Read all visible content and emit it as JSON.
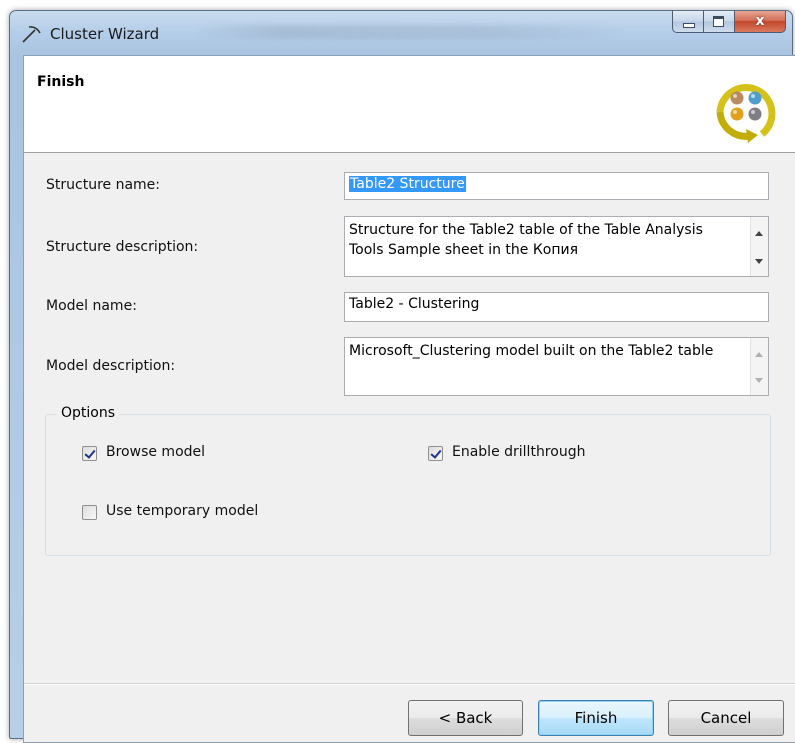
{
  "window": {
    "title": "Cluster Wizard",
    "caption_buttons": {
      "minimize": "minimize",
      "maximize": "maximize",
      "close": "x"
    }
  },
  "header": {
    "title": "Finish",
    "icon": "cluster-wizard-icon"
  },
  "form": {
    "structure_name": {
      "label": "Structure name:",
      "value": "Table2 Structure"
    },
    "structure_description": {
      "label": "Structure description:",
      "value": "Structure for the Table2 table of the Table Analysis Tools Sample sheet in the Копия"
    },
    "model_name": {
      "label": "Model name:",
      "value": "Table2 - Clustering"
    },
    "model_description": {
      "label": "Model description:",
      "value": "Microsoft_Clustering model built on the Table2 table"
    }
  },
  "options": {
    "legend": "Options",
    "browse_model": {
      "label": "Browse model",
      "checked": true
    },
    "enable_drillthrough": {
      "label": "Enable drillthrough",
      "checked": true
    },
    "use_temporary_model": {
      "label": "Use temporary model",
      "checked": false
    }
  },
  "buttons": {
    "back": "< Back",
    "finish": "Finish",
    "cancel": "Cancel"
  }
}
